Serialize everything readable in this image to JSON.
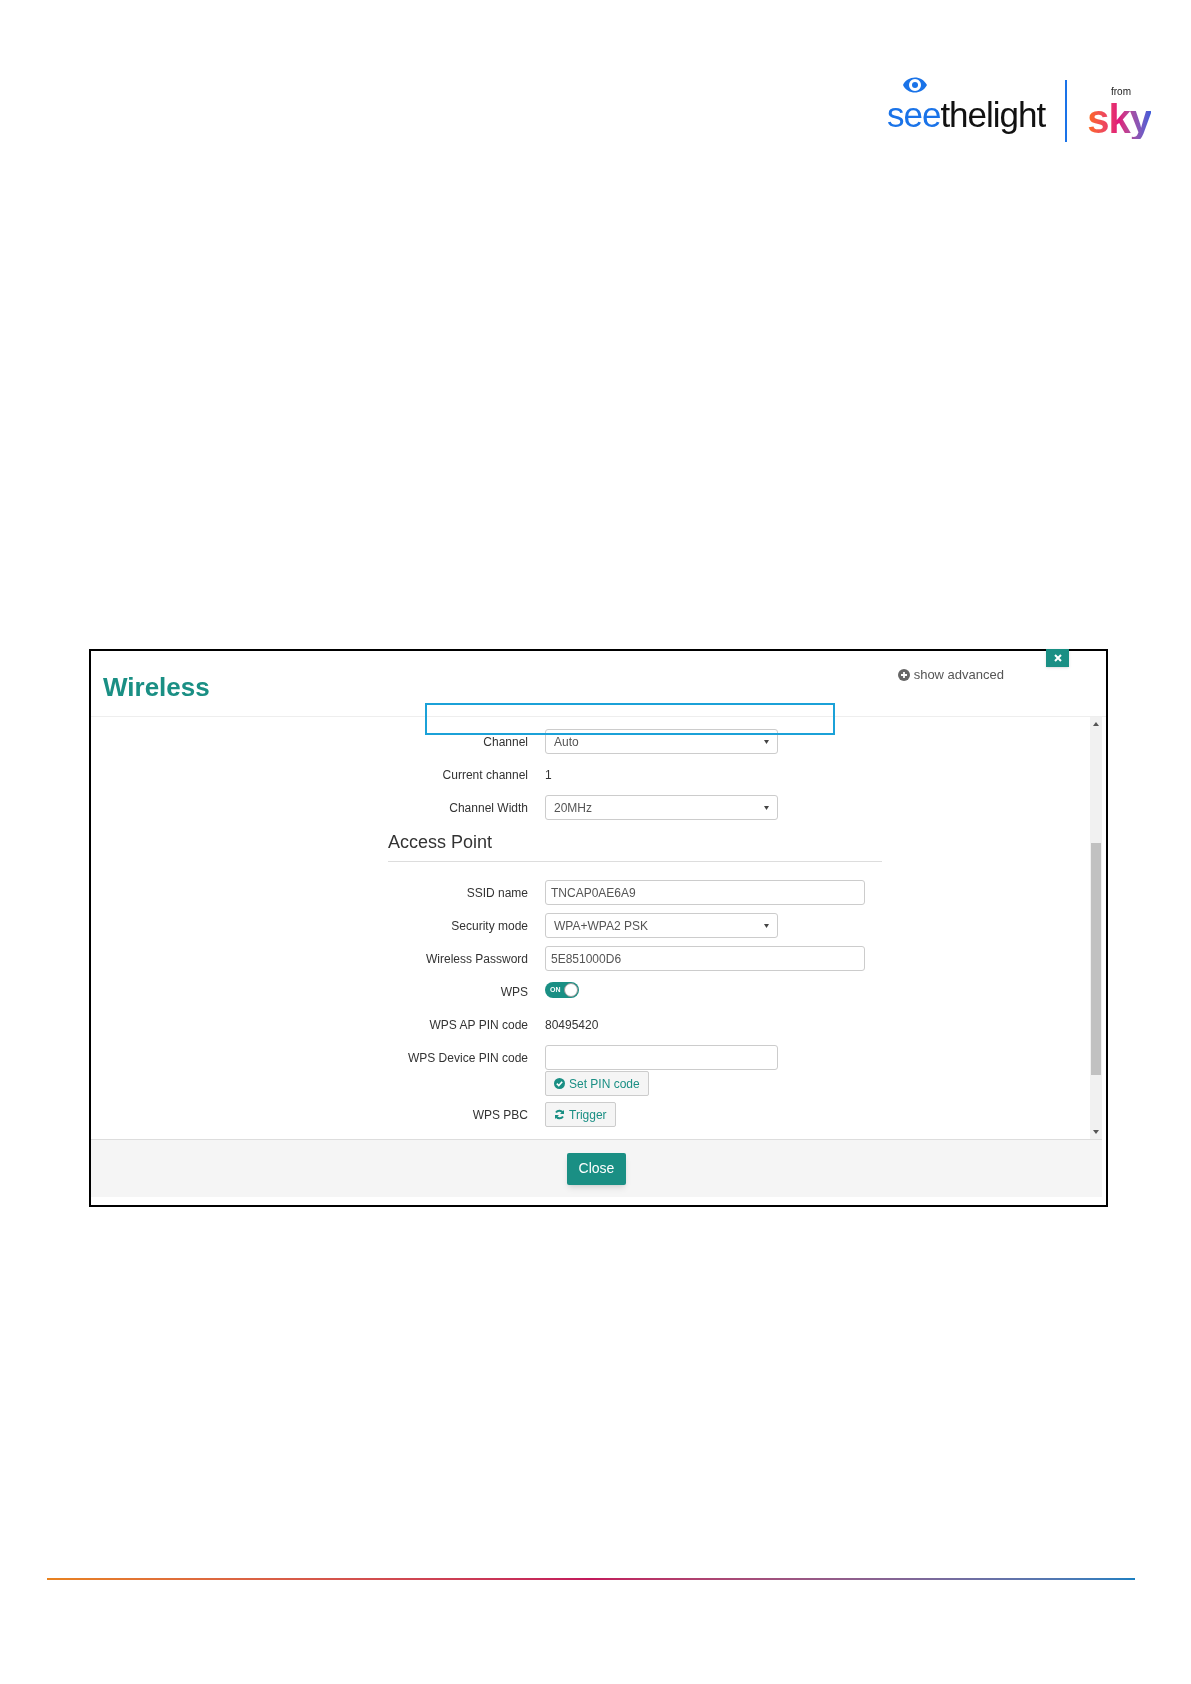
{
  "logo": {
    "brand_part_1": "see",
    "brand_part_2": "thelight",
    "from": "from",
    "partner": "sky"
  },
  "dialog": {
    "title": "Wireless",
    "show_advanced": "show advanced",
    "rows": [
      {
        "kind": "select",
        "label": "Channel",
        "value": "Auto"
      },
      {
        "kind": "text",
        "label": "Current channel",
        "value": "1"
      },
      {
        "kind": "select",
        "label": "Channel Width",
        "value": "20MHz"
      },
      {
        "kind": "heading",
        "label": "Access Point"
      },
      {
        "kind": "input",
        "label": "SSID name",
        "value": "TNCAP0AE6A9"
      },
      {
        "kind": "select",
        "label": "Security mode",
        "value": "WPA+WPA2 PSK"
      },
      {
        "kind": "input",
        "label": "Wireless Password",
        "value": "5E851000D6"
      },
      {
        "kind": "toggle",
        "label": "WPS",
        "on": true,
        "toggle_text": "ON"
      },
      {
        "kind": "text",
        "label": "WPS AP PIN code",
        "value": "80495420"
      },
      {
        "kind": "input_button",
        "label": "WPS Device PIN code",
        "button": "Set PIN code"
      },
      {
        "kind": "button",
        "label": "WPS PBC",
        "button": "Trigger"
      }
    ],
    "footer_button": "Close"
  }
}
